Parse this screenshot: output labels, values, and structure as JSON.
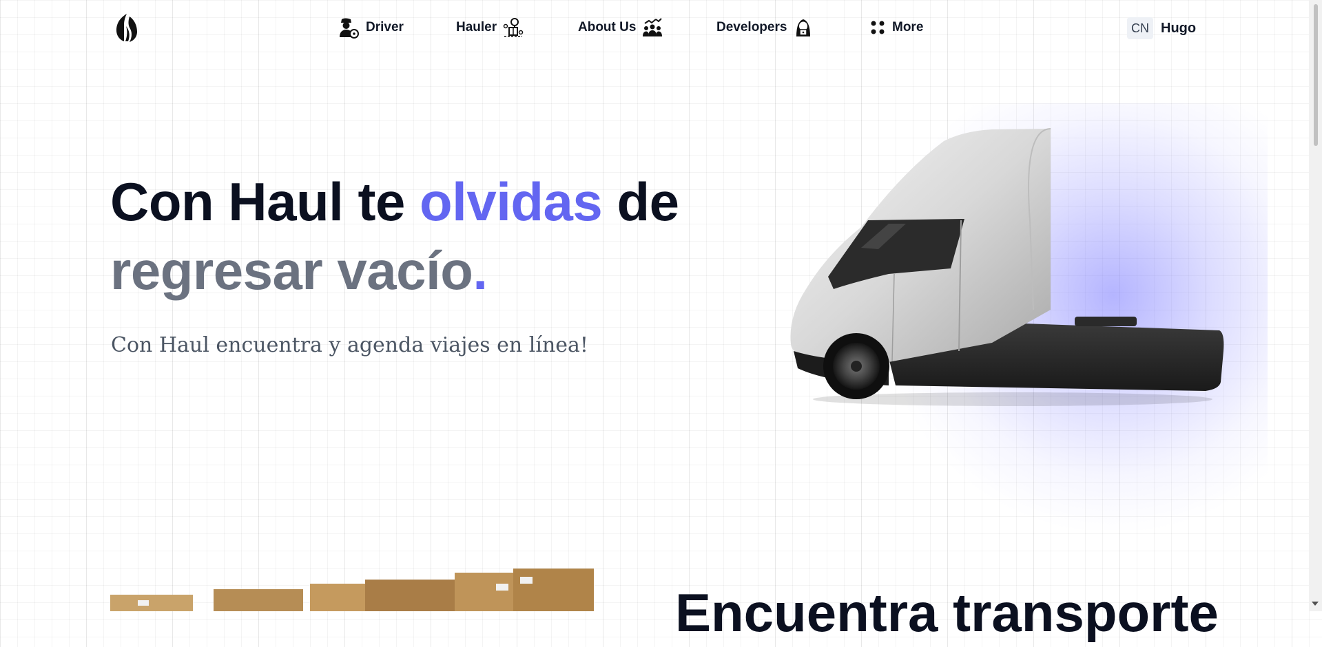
{
  "nav": {
    "items": [
      {
        "label": "Driver",
        "icon": "driver-icon"
      },
      {
        "label": "Hauler",
        "icon": "hauler-icon"
      },
      {
        "label": "About Us",
        "icon": "team-icon"
      },
      {
        "label": "Developers",
        "icon": "hacker-icon"
      },
      {
        "label": "More",
        "icon": "dots-grid-icon"
      }
    ],
    "lang": "CN",
    "user": "Hugo"
  },
  "hero": {
    "title_part1": "Con Haul te ",
    "title_accent": "olvidas",
    "title_part2": " de",
    "title_line2": "regresar vacío",
    "title_dot": ".",
    "subtitle": "Con Haul encuentra y agenda viajes en línea!"
  },
  "section2": {
    "title": "Encuentra transporte"
  },
  "colors": {
    "accent": "#6366f1",
    "heading": "#0b1020",
    "muted": "#6b7280",
    "subtitle": "#4b5563"
  }
}
